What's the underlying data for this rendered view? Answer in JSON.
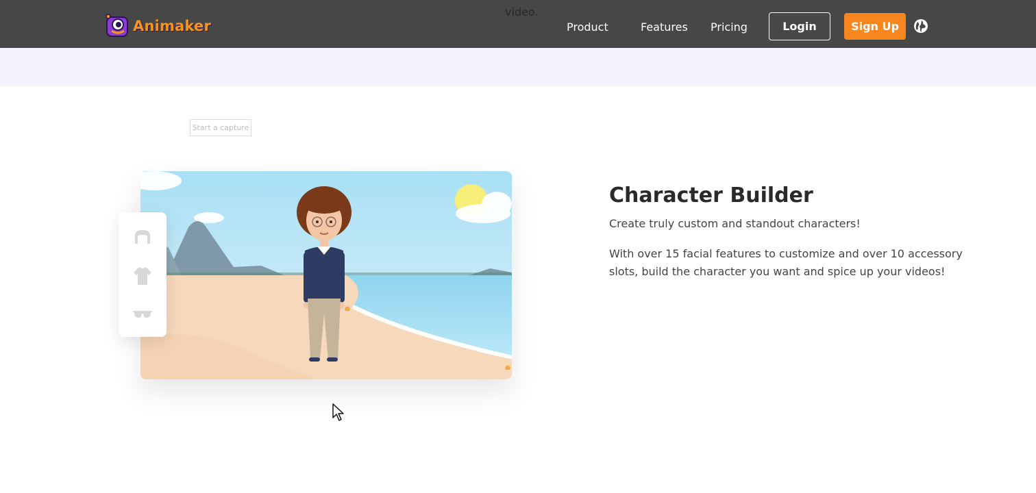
{
  "header": {
    "logo_text": "Animaker",
    "bleed_text": "video.",
    "nav": [
      "Product",
      "Features",
      "Pricing"
    ],
    "login_label": "Login",
    "signup_label": "Sign Up",
    "globe_icon": "globe-icon"
  },
  "capture": {
    "label": "Start a capture"
  },
  "feature": {
    "title": "Character Builder",
    "subtitle": "Create truly custom and standout characters!",
    "description": "With over 15 facial features to customize and over 10 accessory slots, build the character you want and spice up your videos!"
  },
  "sidepanel": {
    "icons": [
      "hair-icon",
      "shirt-icon",
      "glasses-icon"
    ]
  },
  "colors": {
    "header_bg": "#474747",
    "signup_bg": "#f7861f",
    "band_bg": "#f4f1fd"
  }
}
